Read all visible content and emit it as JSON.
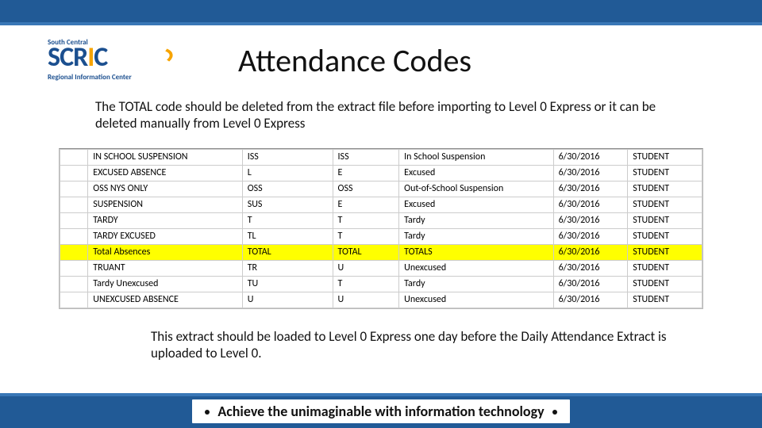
{
  "logo": {
    "top_text": "South Central",
    "main": "SCRIC",
    "tagline": "Regional Information Center"
  },
  "title": "Attendance Codes",
  "intro": "The TOTAL code should be deleted from the extract file before importing to Level 0 Express or it can be deleted manually from Level 0 Express",
  "rows": [
    {
      "desc": "IN SCHOOL SUSPENSION",
      "c1": "ISS",
      "c2": "ISS",
      "long": "In School Suspension",
      "date": "6/30/2016",
      "type": "STUDENT",
      "hl": false
    },
    {
      "desc": "EXCUSED ABSENCE",
      "c1": "L",
      "c2": "E",
      "long": "Excused",
      "date": "6/30/2016",
      "type": "STUDENT",
      "hl": false
    },
    {
      "desc": "OSS NYS ONLY",
      "c1": "OSS",
      "c2": "OSS",
      "long": "Out-of-School Suspension",
      "date": "6/30/2016",
      "type": "STUDENT",
      "hl": false
    },
    {
      "desc": "SUSPENSION",
      "c1": "SUS",
      "c2": "E",
      "long": "Excused",
      "date": "6/30/2016",
      "type": "STUDENT",
      "hl": false
    },
    {
      "desc": "TARDY",
      "c1": "T",
      "c2": "T",
      "long": "Tardy",
      "date": "6/30/2016",
      "type": "STUDENT",
      "hl": false
    },
    {
      "desc": "TARDY EXCUSED",
      "c1": "TL",
      "c2": "T",
      "long": "Tardy",
      "date": "6/30/2016",
      "type": "STUDENT",
      "hl": false
    },
    {
      "desc": "Total Absences",
      "c1": "TOTAL",
      "c2": "TOTAL",
      "long": "TOTALS",
      "date": "6/30/2016",
      "type": "STUDENT",
      "hl": true
    },
    {
      "desc": "TRUANT",
      "c1": "TR",
      "c2": "U",
      "long": "Unexcused",
      "date": "6/30/2016",
      "type": "STUDENT",
      "hl": false
    },
    {
      "desc": "Tardy Unexcused",
      "c1": "TU",
      "c2": "T",
      "long": "Tardy",
      "date": "6/30/2016",
      "type": "STUDENT",
      "hl": false
    },
    {
      "desc": "UNEXCUSED ABSENCE",
      "c1": "U",
      "c2": "U",
      "long": "Unexcused",
      "date": "6/30/2016",
      "type": "STUDENT",
      "hl": false
    }
  ],
  "note": "This extract should be loaded to Level 0 Express one day before the Daily Attendance Extract is uploaded to Level 0.",
  "motto": "Achieve the unimaginable with information technology"
}
